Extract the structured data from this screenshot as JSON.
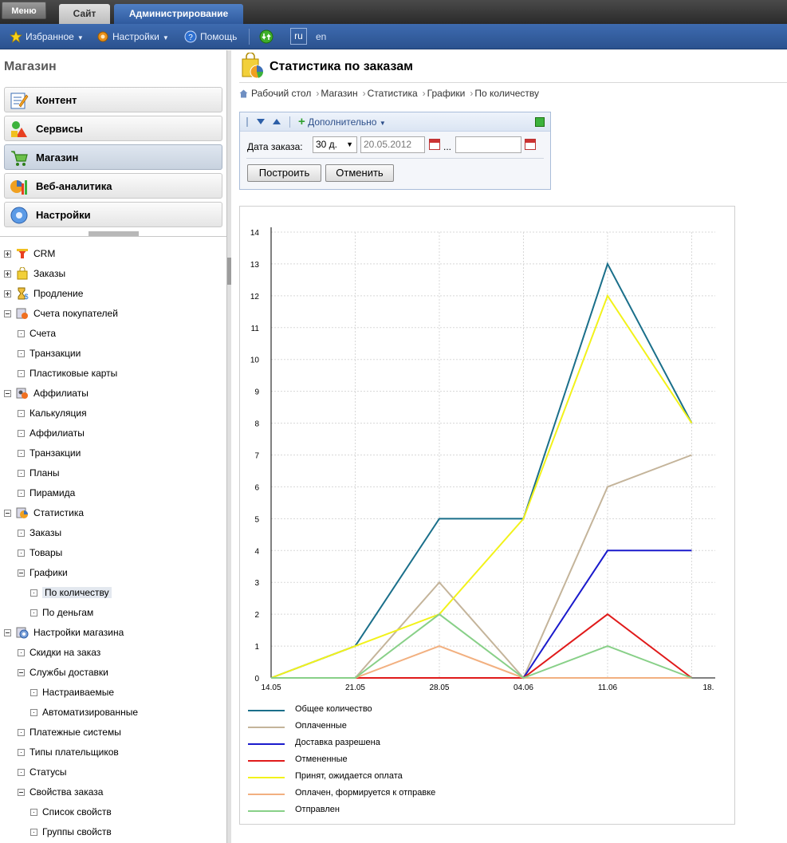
{
  "topbar": {
    "menu_label": "Меню",
    "tabs": [
      {
        "label": "Сайт"
      },
      {
        "label": "Администрирование"
      }
    ]
  },
  "toolbar": {
    "favorites": "Избранное",
    "settings": "Настройки",
    "help": "Помощь",
    "lang_ru": "ru",
    "lang_en": "en"
  },
  "sidebar": {
    "title": "Магазин",
    "sections": [
      {
        "label": "Контент"
      },
      {
        "label": "Сервисы"
      },
      {
        "label": "Магазин"
      },
      {
        "label": "Веб-аналитика"
      },
      {
        "label": "Настройки"
      }
    ],
    "tree": [
      {
        "label": "CRM"
      },
      {
        "label": "Заказы"
      },
      {
        "label": "Продление"
      },
      {
        "label": "Счета покупателей"
      },
      {
        "label": "Счета"
      },
      {
        "label": "Транзакции"
      },
      {
        "label": "Пластиковые карты"
      },
      {
        "label": "Аффилиаты"
      },
      {
        "label": "Калькуляция"
      },
      {
        "label": "Аффилиаты"
      },
      {
        "label": "Транзакции"
      },
      {
        "label": "Планы"
      },
      {
        "label": "Пирамида"
      },
      {
        "label": "Статистика"
      },
      {
        "label": "Заказы"
      },
      {
        "label": "Товары"
      },
      {
        "label": "Графики"
      },
      {
        "label": "По количеству"
      },
      {
        "label": "По деньгам"
      },
      {
        "label": "Настройки магазина"
      },
      {
        "label": "Скидки на заказ"
      },
      {
        "label": "Службы доставки"
      },
      {
        "label": "Настраиваемые"
      },
      {
        "label": "Автоматизированные"
      },
      {
        "label": "Платежные системы"
      },
      {
        "label": "Типы плательщиков"
      },
      {
        "label": "Статусы"
      },
      {
        "label": "Свойства заказа"
      },
      {
        "label": "Список свойств"
      },
      {
        "label": "Группы свойств"
      }
    ]
  },
  "page": {
    "title": "Статистика по заказам",
    "breadcrumb": [
      "Рабочий стол",
      "Магазин",
      "Статистика",
      "Графики",
      "По количеству"
    ]
  },
  "filter": {
    "more_label": "Дополнительно",
    "date_label": "Дата заказа:",
    "period_value": "30 д.",
    "date_from": "20.05.2012",
    "date_to": "",
    "ellipsis": "...",
    "build_button": "Построить",
    "cancel_button": "Отменить"
  },
  "chart_data": {
    "type": "line",
    "x": [
      "14.05",
      "21.05",
      "28.05",
      "04.06",
      "11.06",
      "18."
    ],
    "ylim": [
      0,
      14
    ],
    "yticks": [
      "0",
      "1",
      "2",
      "3",
      "4",
      "5",
      "6",
      "7",
      "8",
      "9",
      "10",
      "11",
      "12",
      "13",
      "14"
    ],
    "grid": true,
    "legend_position": "bottom",
    "series": [
      {
        "name": "Общее количество",
        "color": "#1a6f8a",
        "values": [
          0,
          1,
          5,
          5,
          13,
          8
        ]
      },
      {
        "name": "Оплаченные",
        "color": "#c4b49a",
        "values": [
          0,
          0,
          3,
          0,
          6,
          7
        ]
      },
      {
        "name": "Доставка разрешена",
        "color": "#1a1acc",
        "values": [
          0,
          0,
          0,
          0,
          4,
          4
        ]
      },
      {
        "name": "Отмененные",
        "color": "#e01a1a",
        "values": [
          0,
          0,
          0,
          0,
          2,
          0
        ]
      },
      {
        "name": "Принят, ожидается оплата",
        "color": "#f2f21a",
        "values": [
          0,
          1,
          2,
          5,
          12,
          8
        ]
      },
      {
        "name": "Оплачен, формируется к отправке",
        "color": "#f2b080",
        "values": [
          0,
          0,
          1,
          0,
          0,
          0
        ]
      },
      {
        "name": "Отправлен",
        "color": "#88d088",
        "values": [
          0,
          0,
          2,
          0,
          1,
          0
        ]
      }
    ]
  }
}
